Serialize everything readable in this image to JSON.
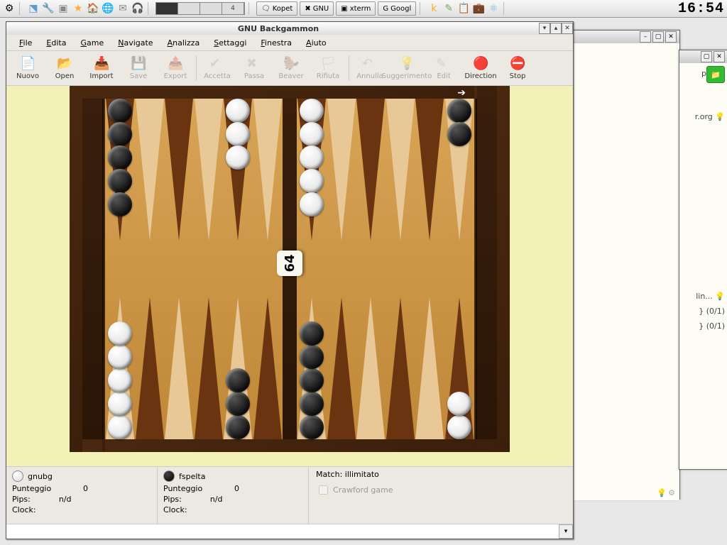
{
  "clock": "16:54",
  "taskbar": {
    "pager": [
      "",
      "",
      "",
      "4"
    ],
    "pager_active": 0,
    "tasks": [
      {
        "icon": "🗨",
        "label": "Kopet"
      },
      {
        "icon": "✖",
        "label": "GNU"
      },
      {
        "icon": "▣",
        "label": "xterm"
      },
      {
        "icon": "G",
        "label": "Googl"
      }
    ]
  },
  "bgwin1": {
    "lines": [
      "p",
      "r.org",
      "lin...",
      "} (0/1)",
      "} (0/1)"
    ]
  },
  "gnubg": {
    "title": "GNU Backgammon",
    "menubar": [
      "File",
      "Edita",
      "Game",
      "Navigate",
      "Analizza",
      "Settaggi",
      "Finestra",
      "Aiuto"
    ],
    "toolbar": [
      {
        "id": "new",
        "label": "Nuovo",
        "enabled": true
      },
      {
        "id": "open",
        "label": "Open",
        "enabled": true
      },
      {
        "id": "import",
        "label": "Import",
        "enabled": true
      },
      {
        "id": "save",
        "label": "Save",
        "enabled": false
      },
      {
        "id": "export",
        "label": "Export",
        "enabled": false
      },
      {
        "sep": true
      },
      {
        "id": "accept",
        "label": "Accetta",
        "enabled": false
      },
      {
        "id": "pass",
        "label": "Passa",
        "enabled": false
      },
      {
        "id": "beaver",
        "label": "Beaver",
        "enabled": false
      },
      {
        "id": "refuse",
        "label": "Rifiuta",
        "enabled": false
      },
      {
        "sep": true
      },
      {
        "id": "undo",
        "label": "Annulla",
        "enabled": false
      },
      {
        "id": "hint",
        "label": "Suggerimento",
        "enabled": false
      },
      {
        "id": "edit",
        "label": "Edit",
        "enabled": false
      },
      {
        "id": "direction",
        "label": "Direction",
        "enabled": true
      },
      {
        "id": "stop",
        "label": "Stop",
        "enabled": true
      }
    ],
    "cube": "64",
    "players": [
      {
        "color": "white",
        "name": "gnubg",
        "score_label": "Punteggio",
        "score": "0",
        "pips_label": "Pips:",
        "pips": "n/d",
        "clock_label": "Clock:"
      },
      {
        "color": "black",
        "name": "fspelta",
        "score_label": "Punteggio",
        "score": "0",
        "pips_label": "Pips:",
        "pips": "n/d",
        "clock_label": "Clock:"
      }
    ],
    "match": {
      "label": "Match:",
      "value": "illimitato",
      "crawford": "Crawford game"
    },
    "board": {
      "top": {
        "left": [
          {
            "c": "black",
            "n": 5
          },
          null,
          null,
          null,
          {
            "c": "white",
            "n": 3
          },
          null
        ],
        "right": [
          {
            "c": "white",
            "n": 5
          },
          null,
          null,
          null,
          null,
          {
            "c": "black",
            "n": 2
          }
        ]
      },
      "bot": {
        "left": [
          {
            "c": "white",
            "n": 5
          },
          null,
          null,
          null,
          {
            "c": "black",
            "n": 3
          },
          null
        ],
        "right": [
          {
            "c": "black",
            "n": 5
          },
          null,
          null,
          null,
          null,
          {
            "c": "white",
            "n": 2
          }
        ]
      }
    }
  }
}
